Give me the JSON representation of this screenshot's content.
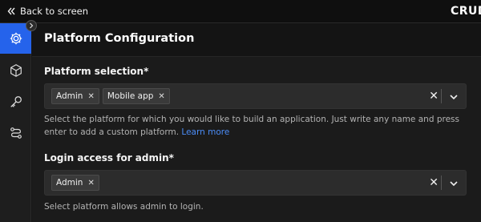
{
  "topbar": {
    "back_label": "Back to screen",
    "brand": "CRUD"
  },
  "header": {
    "title": "Platform Configuration"
  },
  "sidebar": {
    "items": [
      {
        "icon": "settings-gear-icon",
        "active": true
      },
      {
        "icon": "cube-icon",
        "active": false
      },
      {
        "icon": "key-icon",
        "active": false
      },
      {
        "icon": "flow-icon",
        "active": false
      }
    ]
  },
  "platform_selection": {
    "label": "Platform selection*",
    "chips": [
      "Admin",
      "Mobile app"
    ],
    "help_text": "Select the platform for which you would like to build an application. Just write any name and press enter to add a custom platform.",
    "learn_more": "Learn more"
  },
  "login_access": {
    "label": "Login access for admin*",
    "chips": [
      "Admin"
    ],
    "help_text": "Select platform allows admin to login."
  },
  "colors": {
    "accent": "#2563eb",
    "link": "#4b8df8",
    "background": "#161616"
  }
}
